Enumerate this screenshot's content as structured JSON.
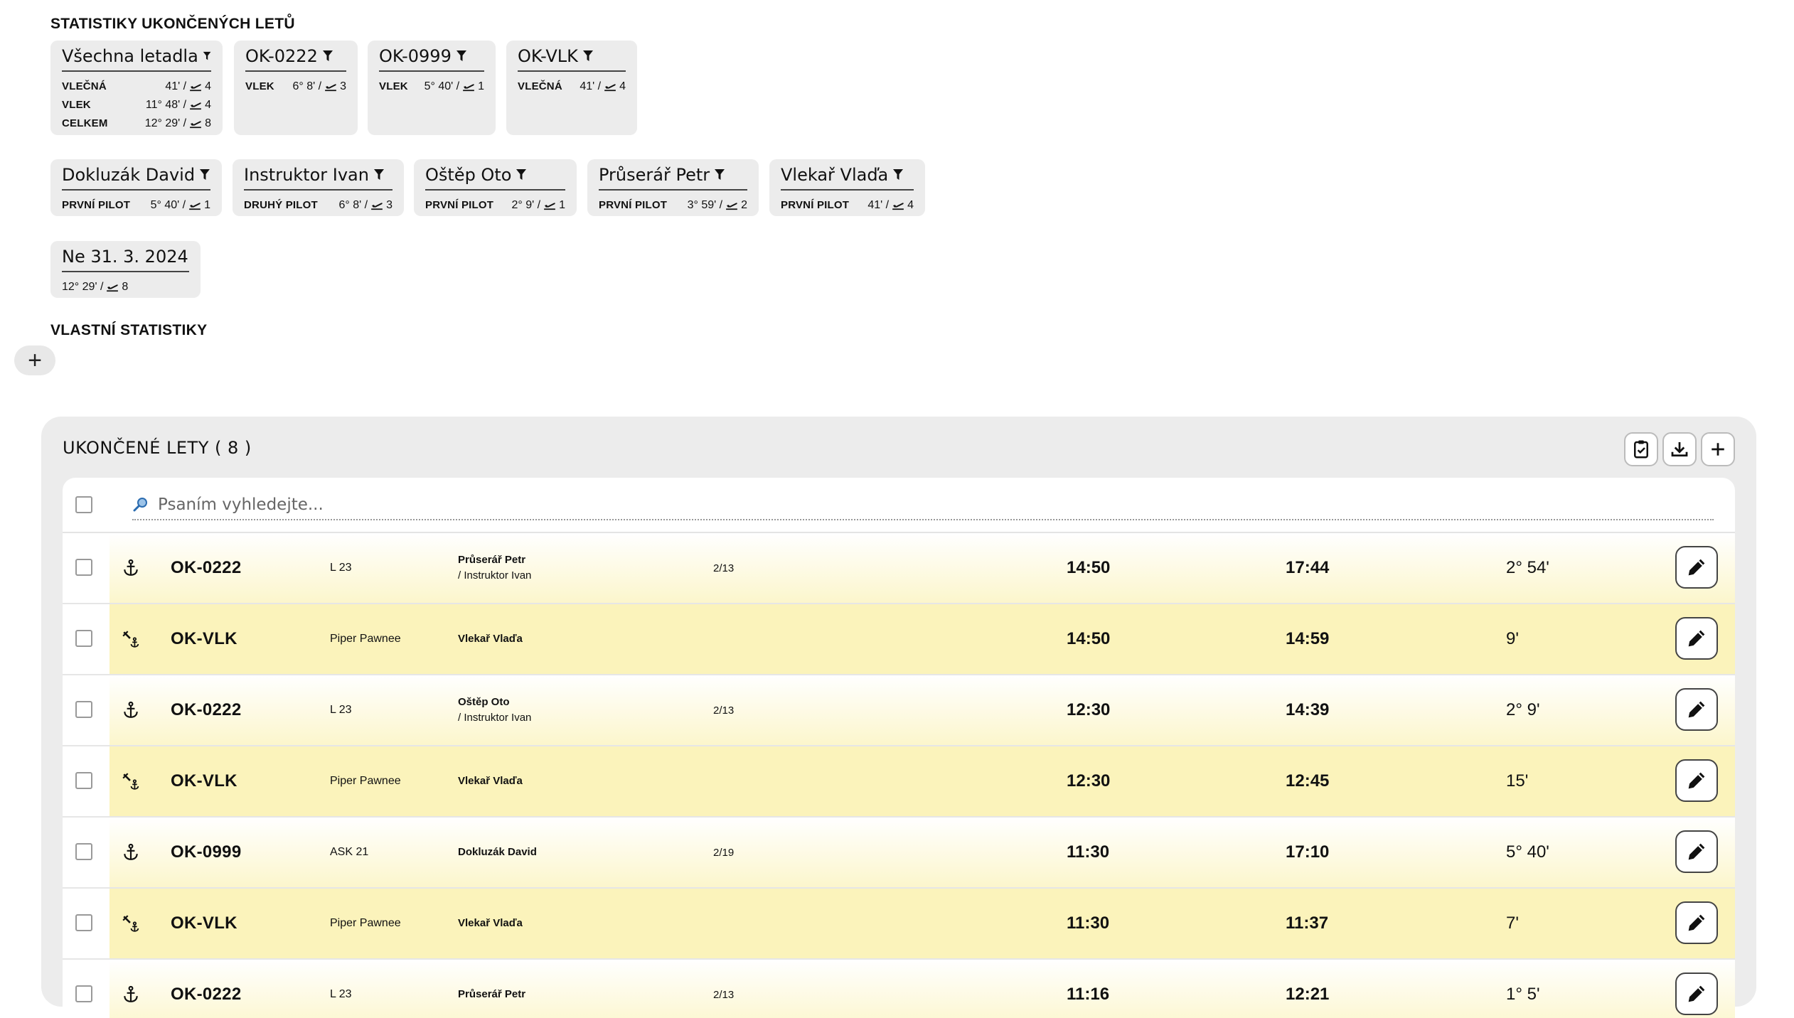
{
  "stats_title": "STATISTIKY UKONČENÝCH LETŮ",
  "aircraft_cards": [
    {
      "title": "Všechna letadla",
      "rows": [
        {
          "label": "VLEČNÁ",
          "value": "41' / ",
          "count": "4"
        },
        {
          "label": "VLEK",
          "value": "11° 48' / ",
          "count": "4"
        },
        {
          "label": "CELKEM",
          "value": "12° 29' / ",
          "count": "8"
        }
      ]
    },
    {
      "title": "OK-0222",
      "rows": [
        {
          "label": "VLEK",
          "value": "6° 8' / ",
          "count": "3"
        }
      ]
    },
    {
      "title": "OK-0999",
      "rows": [
        {
          "label": "VLEK",
          "value": "5° 40' / ",
          "count": "1"
        }
      ]
    },
    {
      "title": "OK-VLK",
      "rows": [
        {
          "label": "VLEČNÁ",
          "value": "41' / ",
          "count": "4"
        }
      ]
    }
  ],
  "pilot_cards": [
    {
      "title": "Dokluzák David",
      "rows": [
        {
          "label": "PRVNÍ PILOT",
          "value": "5° 40' / ",
          "count": "1"
        }
      ]
    },
    {
      "title": "Instruktor Ivan",
      "rows": [
        {
          "label": "DRUHÝ PILOT",
          "value": "6° 8' / ",
          "count": "3"
        }
      ]
    },
    {
      "title": "Oštěp Oto",
      "rows": [
        {
          "label": "PRVNÍ PILOT",
          "value": "2° 9' / ",
          "count": "1"
        }
      ]
    },
    {
      "title": "Průserář Petr",
      "rows": [
        {
          "label": "PRVNÍ PILOT",
          "value": "3° 59' / ",
          "count": "2"
        }
      ]
    },
    {
      "title": "Vlekař Vlaďa",
      "rows": [
        {
          "label": "PRVNÍ PILOT",
          "value": "41' / ",
          "count": "4"
        }
      ]
    }
  ],
  "date_cards": [
    {
      "title": "Ne 31. 3. 2024",
      "rows": [
        {
          "label": "",
          "value": "12° 29' / ",
          "count": "8"
        }
      ]
    }
  ],
  "custom_title": "VLASTNÍ STATISTIKY",
  "panel": {
    "title": "UKONČENÉ LETY ( 8 )",
    "search_placeholder": "Psaním vyhledejte...",
    "flights": [
      {
        "kind": "glider",
        "reg": "OK-0222",
        "model": "L 23",
        "pilot1": "Průserář Petr",
        "pilot2": " / Instruktor Ivan",
        "task": "2/13",
        "start": "14:50",
        "end": "17:44",
        "duration": "2° 54'"
      },
      {
        "kind": "tow",
        "reg": "OK-VLK",
        "model": "Piper Pawnee",
        "pilot1": "Vlekař Vlaďa",
        "pilot2": "",
        "task": "",
        "start": "14:50",
        "end": "14:59",
        "duration": "9'"
      },
      {
        "kind": "glider",
        "reg": "OK-0222",
        "model": "L 23",
        "pilot1": "Oštěp Oto",
        "pilot2": " / Instruktor Ivan",
        "task": "2/13",
        "start": "12:30",
        "end": "14:39",
        "duration": "2° 9'"
      },
      {
        "kind": "tow",
        "reg": "OK-VLK",
        "model": "Piper Pawnee",
        "pilot1": "Vlekař Vlaďa",
        "pilot2": "",
        "task": "",
        "start": "12:30",
        "end": "12:45",
        "duration": "15'"
      },
      {
        "kind": "glider",
        "reg": "OK-0999",
        "model": "ASK 21",
        "pilot1": "Dokluzák David",
        "pilot2": "",
        "task": "2/19",
        "start": "11:30",
        "end": "17:10",
        "duration": "5° 40'"
      },
      {
        "kind": "tow",
        "reg": "OK-VLK",
        "model": "Piper Pawnee",
        "pilot1": "Vlekař Vlaďa",
        "pilot2": "",
        "task": "",
        "start": "11:30",
        "end": "11:37",
        "duration": "7'"
      },
      {
        "kind": "glider",
        "reg": "OK-0222",
        "model": "L 23",
        "pilot1": "Průserář Petr",
        "pilot2": "",
        "task": "2/13",
        "start": "11:16",
        "end": "12:21",
        "duration": "1° 5'"
      }
    ]
  }
}
